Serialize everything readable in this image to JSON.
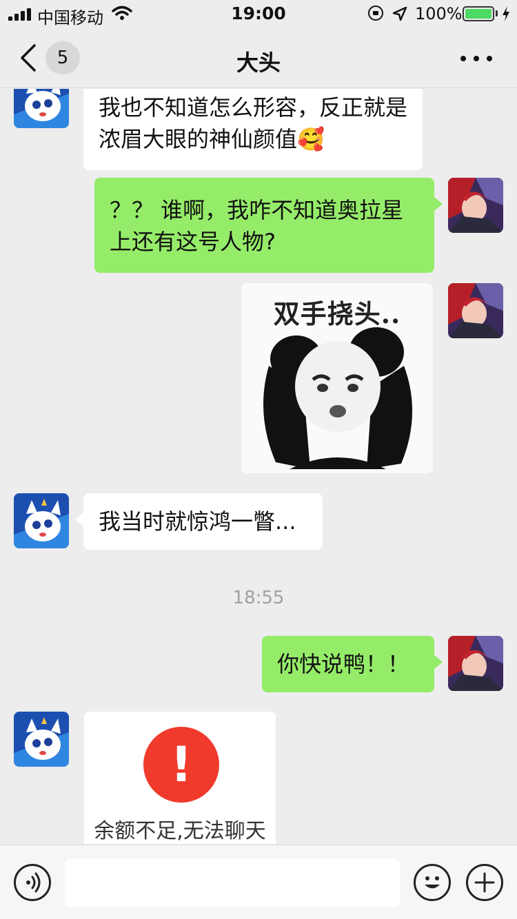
{
  "status_bar": {
    "carrier": "中国移动",
    "time": "19:00",
    "battery": "100%",
    "battery_level": 1.0
  },
  "nav": {
    "unread_count": "5",
    "title": "大头"
  },
  "messages": [
    {
      "side": "in",
      "text": "我也不知道怎么形容，反正就是 浓眉大眼的神仙颜值🥰"
    },
    {
      "side": "out",
      "text": "？？ 谁啊，我咋不知道奥拉星上还有这号人物?"
    },
    {
      "side": "out",
      "sticker_caption": "双手挠头.."
    },
    {
      "side": "in",
      "text": "我当时就惊鸿一瞥..."
    },
    {
      "timestamp": "18:55"
    },
    {
      "side": "out",
      "text": "你快说鸭！！"
    },
    {
      "side": "in",
      "error_text": "余额不足,无法聊天"
    }
  ],
  "input": {
    "value": ""
  },
  "colors": {
    "background": "#ededed",
    "outgoing_bubble": "#95ec69",
    "incoming_bubble": "#ffffff",
    "error_red": "#f03a2b",
    "battery_green": "#4cd964"
  },
  "icons": [
    "signal-icon",
    "wifi-icon",
    "rotation-lock-icon",
    "location-icon",
    "battery-icon",
    "charging-icon",
    "back-chevron-icon",
    "more-icon",
    "voice-icon",
    "emoji-icon",
    "plus-icon"
  ]
}
